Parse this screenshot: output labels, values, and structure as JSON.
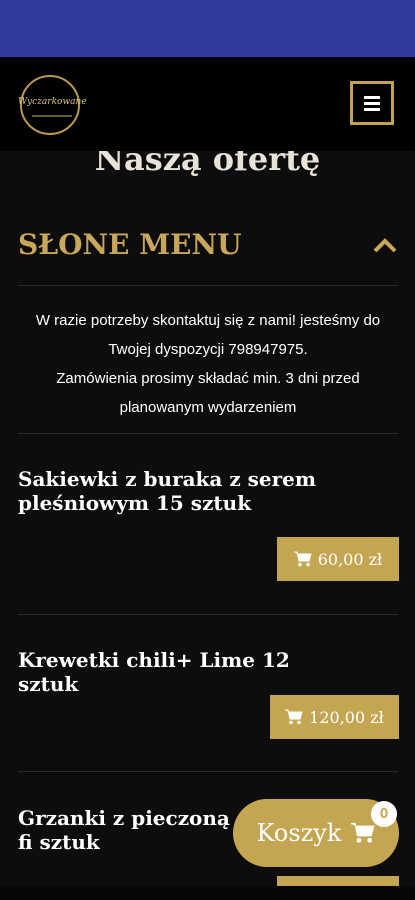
{
  "header": {
    "logo_text": "Wyczarkowane",
    "menu_icon": "hamburger-icon"
  },
  "section_title": "Naszą ofertę",
  "accordion": {
    "title": "SŁONE MENU",
    "chevron_icon": "chevron-up-icon",
    "info_line1": "W razie potrzeby skontaktuj się z nami! jesteśmy do Twojej dyspozycji 798947975.",
    "info_line2": "Zamówienia prosimy składać min. 3 dni przed planowanym wydarzeniem"
  },
  "products": [
    {
      "name": "Sakiewki z buraka z serem pleśniowym 15 sztuk",
      "price": "60,00 zł"
    },
    {
      "name": "Krewetki chili+ Lime 12 sztuk",
      "price": "120,00 zł"
    },
    {
      "name": "Grzanki z pieczoną fi sztuk",
      "price": ""
    }
  ],
  "cart": {
    "label": "Koszyk",
    "count": "0",
    "icon": "cart-icon"
  },
  "colors": {
    "accent": "#c4a552",
    "top_bar": "#2f3a9c",
    "background": "#0e0d0d"
  }
}
